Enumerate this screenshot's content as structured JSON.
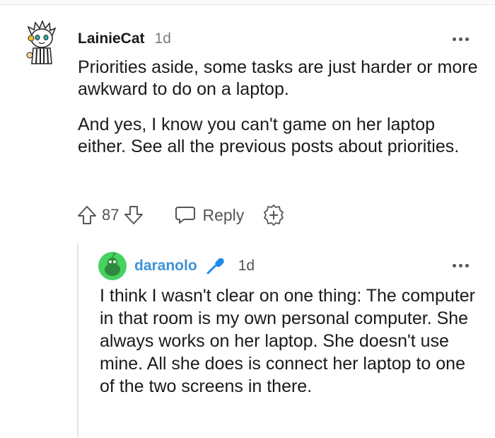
{
  "comment": {
    "author": "LainieCat",
    "age": "1d",
    "paragraphs": [
      "Priorities aside, some tasks are just harder or more awkward to do on a laptop.",
      "And yes, I know you can't game on her laptop either. See all the previous posts about priorities."
    ],
    "votes": "87",
    "reply_label": "Reply",
    "icons": [
      "upvote-icon",
      "downvote-icon",
      "reply-bubble-icon",
      "award-plus-icon",
      "more-options-icon"
    ]
  },
  "reply": {
    "author": "daranolo",
    "age": "1d",
    "text": "I think I wasn't clear on one thing: The computer in that room is my own personal computer. She always works on her laptop. She doesn't use mine. All she does is connect her laptop to one of the two screens in there.",
    "author_color": "#3d92d8",
    "icons": [
      "microphone-icon",
      "more-options-icon"
    ]
  },
  "colors": {
    "text": "#1a1a1b",
    "muted": "#7c7c7c",
    "thread_line": "#e4e4e4",
    "avatar_green": "#46d160"
  }
}
